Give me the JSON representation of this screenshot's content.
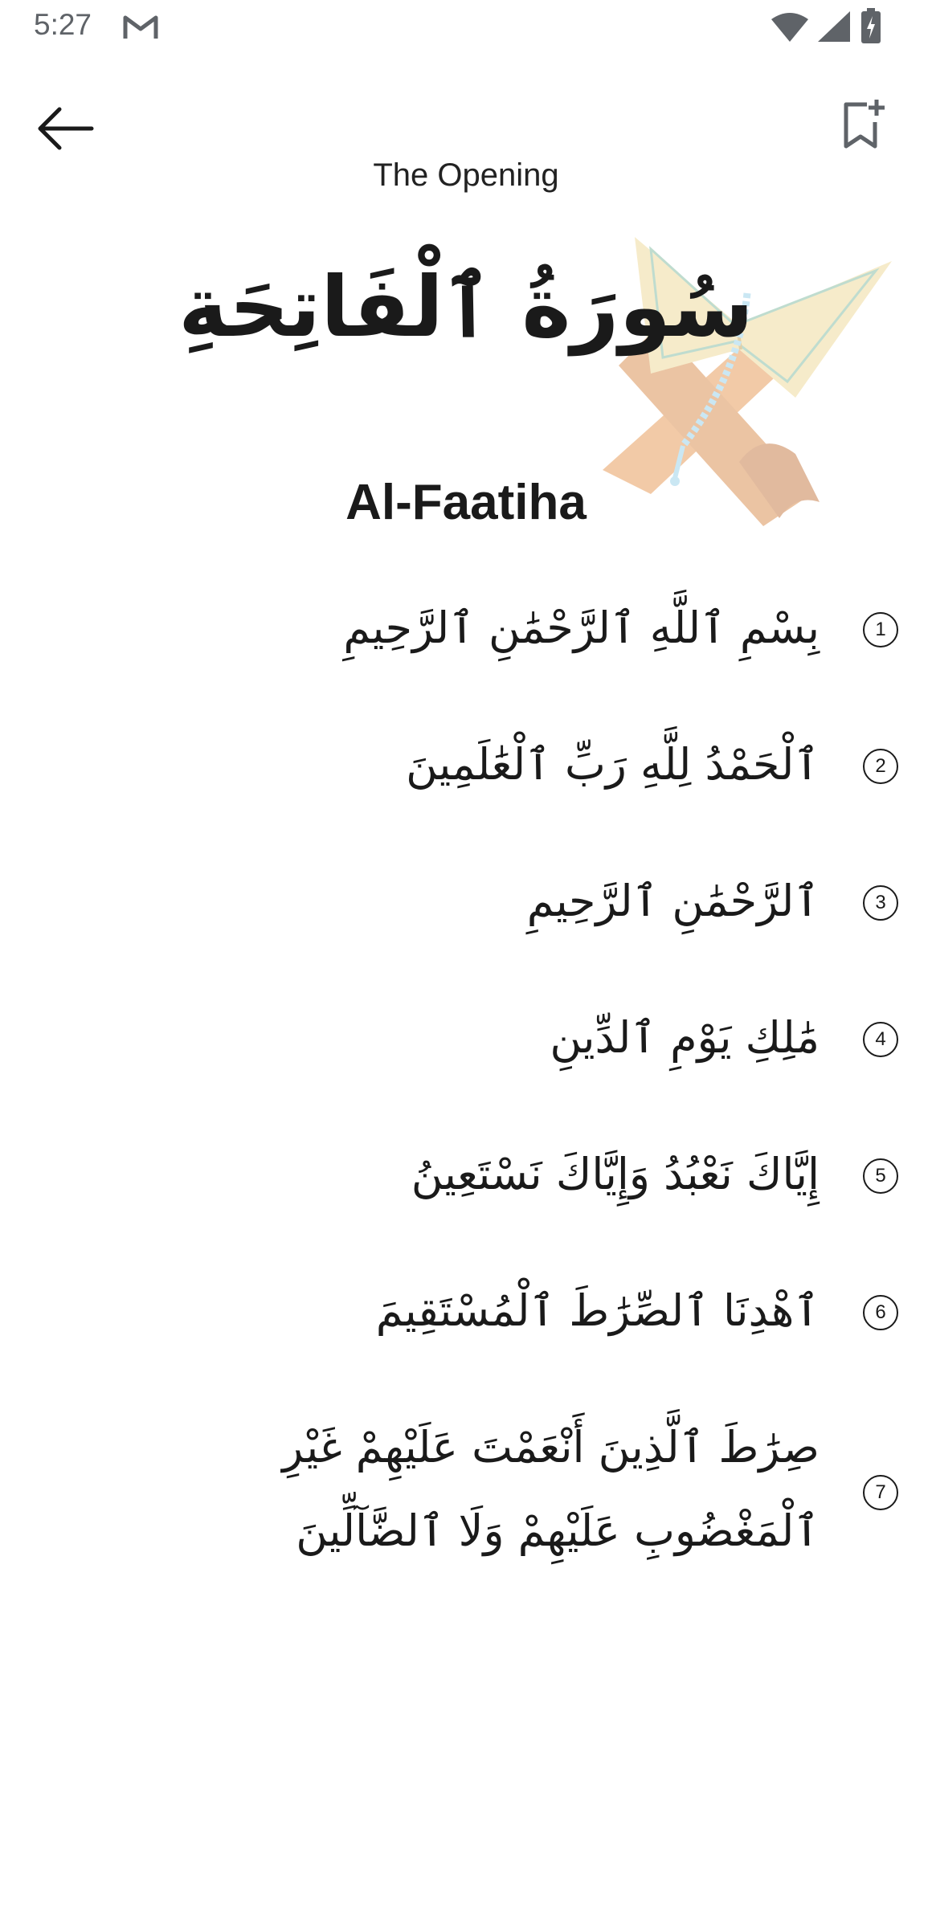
{
  "status_bar": {
    "time": "5:27",
    "icons": [
      "gmail-icon",
      "wifi-icon",
      "signal-icon",
      "battery-icon"
    ]
  },
  "app_bar": {
    "back_icon": "arrow-left-icon",
    "bookmark_icon": "bookmark-add-icon",
    "subtitle": "The Opening"
  },
  "header": {
    "surah_name_arabic": "سُورَةُ ٱلْفَاتِحَةِ",
    "surah_name_latin": "Al-Faatiha",
    "illustration": "quran-on-stand-icon"
  },
  "verses": [
    {
      "number": "1",
      "text": "بِسْمِ ٱللَّهِ ٱلرَّحْمَٰنِ ٱلرَّحِيمِ"
    },
    {
      "number": "2",
      "text": "ٱلْحَمْدُ لِلَّهِ رَبِّ ٱلْعَٰلَمِينَ"
    },
    {
      "number": "3",
      "text": "ٱلرَّحْمَٰنِ ٱلرَّحِيمِ"
    },
    {
      "number": "4",
      "text": "مَٰلِكِ يَوْمِ ٱلدِّينِ"
    },
    {
      "number": "5",
      "text": "إِيَّاكَ نَعْبُدُ وَإِيَّاكَ نَسْتَعِينُ"
    },
    {
      "number": "6",
      "text": "ٱهْدِنَا ٱلصِّرَٰطَ ٱلْمُسْتَقِيمَ"
    },
    {
      "number": "7",
      "text": "صِرَٰطَ ٱلَّذِينَ أَنْعَمْتَ عَلَيْهِمْ غَيْرِ ٱلْمَغْضُوبِ عَلَيْهِمْ وَلَا ٱلضَّآلِّينَ"
    }
  ],
  "colors": {
    "text": "#1a1a1a",
    "status": "#5f6368",
    "background": "#ffffff",
    "illustration_wood": "#e8a060",
    "illustration_book": "#f0dca0",
    "illustration_beads": "#9fd4ea"
  }
}
